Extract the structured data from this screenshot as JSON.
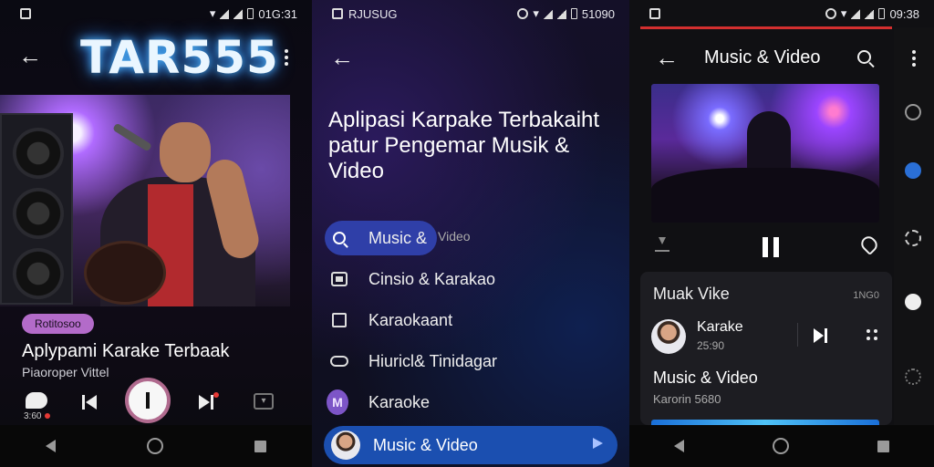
{
  "screen1": {
    "status_time": "01G:31",
    "logo": "TAR555",
    "badge": "Rotitosoo",
    "title": "Aplypami Karake Terbaak",
    "subtitle": "Piaoroper Vittel",
    "chat_count": "3:60",
    "drop_glyph": "▾"
  },
  "screen2": {
    "status_carrier": "RJUSUG",
    "status_time": "51090",
    "heading_lines": [
      "Aplipasi Karpake Terbakaiht",
      "patur Pengemar Musik &",
      "Video"
    ],
    "menu": [
      {
        "label": "Music &",
        "icon": "search-icon",
        "active": true
      },
      {
        "label": "Cinsio & Karakao",
        "icon": "box-icon"
      },
      {
        "label": "Karaokaant",
        "icon": "home-icon"
      },
      {
        "label": "Hiuricl& Tinidagar",
        "icon": "cloud-icon"
      },
      {
        "label": "Karaoke",
        "icon": "karaoke-app-icon"
      }
    ],
    "active_tail": "Video",
    "karaoke_letter": "M",
    "bottom_label": "Music & Video"
  },
  "screen3": {
    "status_time": "09:38",
    "title": "Music & Video",
    "card_heading": "Muak Vike",
    "card_meta": "1NG0",
    "track_name": "Karake",
    "track_time": "25:90",
    "card_title": "Music & Video",
    "card_subtitle": "Karorin 5680"
  }
}
